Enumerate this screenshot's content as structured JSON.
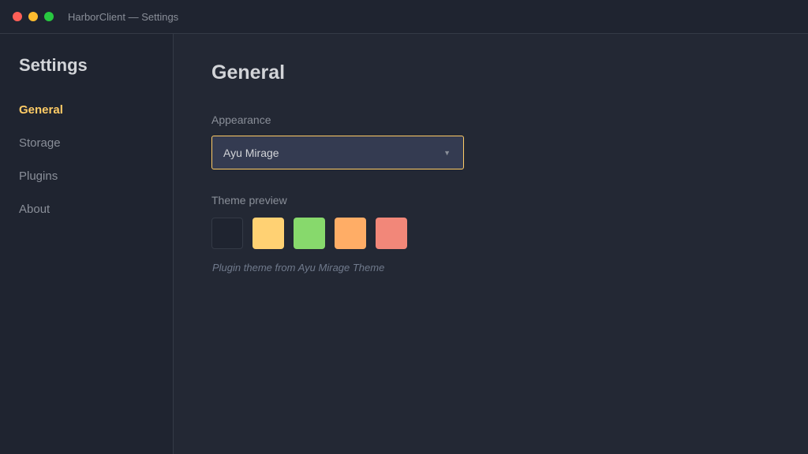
{
  "window": {
    "title": "HarborClient — Settings",
    "controls": [
      {
        "name": "close",
        "color": "#ff5f57"
      },
      {
        "name": "minimize",
        "color": "#febc2e"
      },
      {
        "name": "maximize",
        "color": "#28c840"
      }
    ]
  },
  "sidebar": {
    "title": "Settings",
    "items": [
      {
        "label": "General",
        "active": true
      },
      {
        "label": "Storage",
        "active": false
      },
      {
        "label": "Plugins",
        "active": false
      },
      {
        "label": "About",
        "active": false
      }
    ]
  },
  "main": {
    "title": "General",
    "appearance": {
      "label": "Appearance",
      "selected": "Ayu Mirage",
      "caret_icon": "chevron-down-icon"
    },
    "theme_preview": {
      "label": "Theme preview",
      "swatches": [
        "#1f2430",
        "#ffd173",
        "#87d96c",
        "#ffad66",
        "#f28779"
      ],
      "note": "Plugin theme from Ayu Mirage Theme"
    }
  },
  "colors": {
    "accent": "#ffcc66",
    "background": "#232834",
    "sidebar": "#1f2430"
  }
}
